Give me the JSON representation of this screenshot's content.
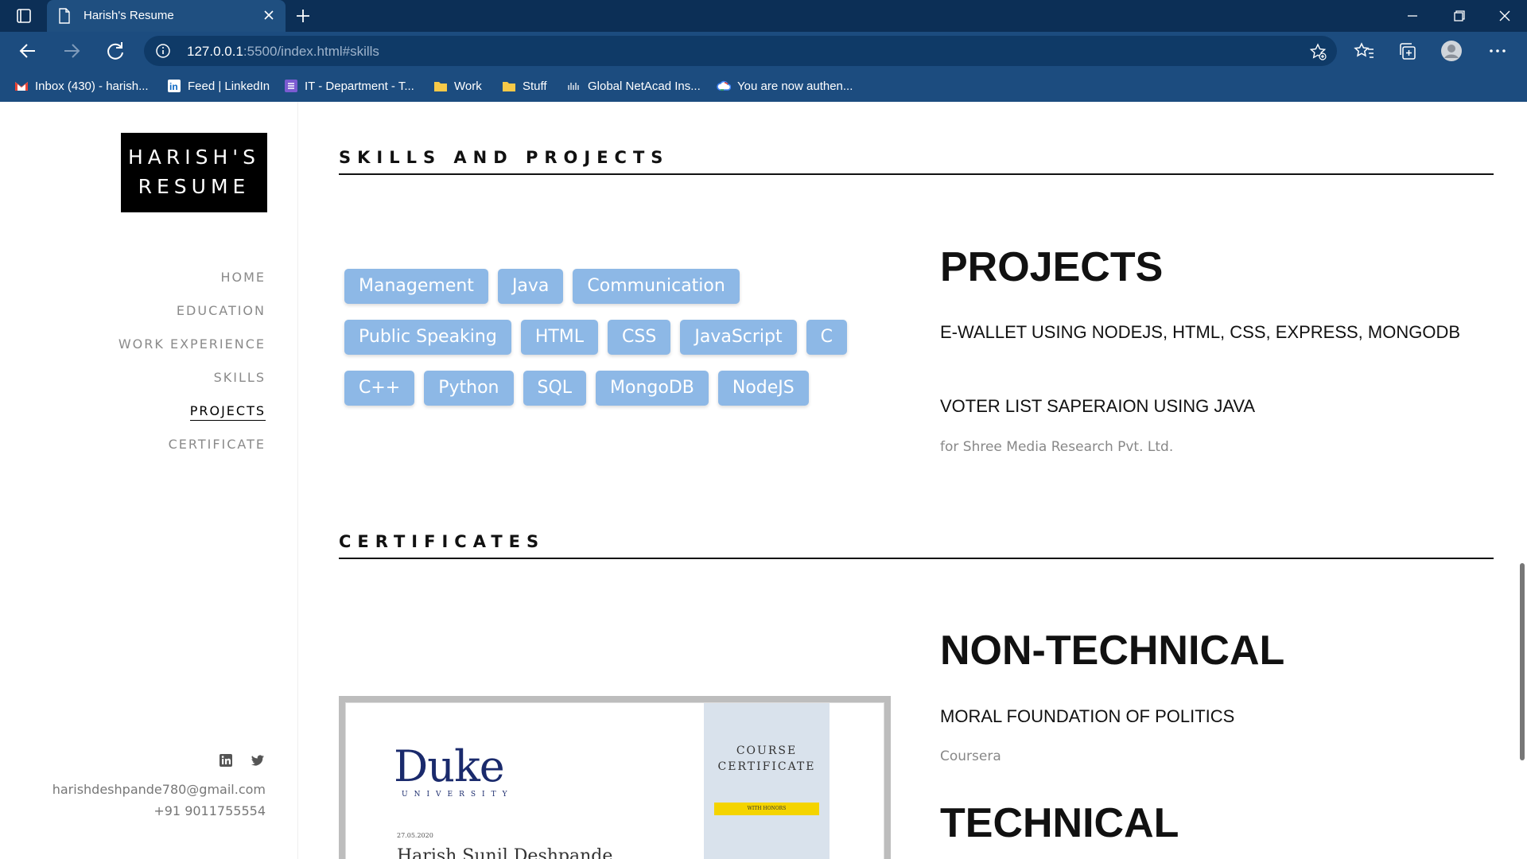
{
  "browser": {
    "tab_title": "Harish's Resume",
    "url_host": "127.0.0.1",
    "url_path": ":5500/index.html#skills",
    "bookmarks": [
      {
        "label": "Inbox (430) - harish...",
        "icon": "gmail-icon"
      },
      {
        "label": "Feed | LinkedIn",
        "icon": "linkedin-icon"
      },
      {
        "label": "IT - Department - T...",
        "icon": "list-icon"
      },
      {
        "label": "Work",
        "icon": "folder-icon"
      },
      {
        "label": "Stuff",
        "icon": "folder-icon"
      },
      {
        "label": "Global NetAcad Ins...",
        "icon": "netacad-icon"
      },
      {
        "label": "You are now authen...",
        "icon": "google-cloud-icon"
      }
    ]
  },
  "sidebar": {
    "logo_line1": "HARISH'S",
    "logo_line2": "RESUME",
    "nav": [
      "HOME",
      "EDUCATION",
      "WORK EXPERIENCE",
      "SKILLS",
      "PROJECTS",
      "CERTIFICATE"
    ],
    "active_nav": "PROJECTS",
    "email": "harishdeshpande780@gmail.com",
    "phone": "+91 9011755554"
  },
  "skills_section": {
    "heading": "SKILLS AND PROJECTS",
    "skills": [
      [
        "Management",
        "Java",
        "Communication"
      ],
      [
        "Public Speaking",
        "HTML",
        "CSS",
        "JavaScript",
        "C"
      ],
      [
        "C++",
        "Python",
        "SQL",
        "MongoDB",
        "NodeJS"
      ]
    ],
    "projects_title": "PROJECTS",
    "project1": "E-WALLET USING NODEJS, HTML, CSS, EXPRESS, MONGODB",
    "project2": "VOTER LIST SAPERAION USING JAVA",
    "project2_sub": "for Shree Media Research Pvt. Ltd."
  },
  "certificates_section": {
    "heading": "CERTIFICATES",
    "non_technical_title": "NON-TECHNICAL",
    "cert1": "MORAL FOUNDATION OF POLITICS",
    "cert1_sub": "Coursera",
    "technical_title": "TECHNICAL",
    "cert_image": {
      "org": "Duke",
      "org_sub": "UNIVERSITY",
      "date": "27.05.2020",
      "name": "Harish Sunil Deshpande",
      "course_line1": "COURSE",
      "course_line2": "CERTIFICATE",
      "honors": "WITH HONORS"
    }
  },
  "colors": {
    "chrome": "#0c2f56",
    "navbar": "#1c4c7f",
    "pill": "#8db8e6"
  }
}
